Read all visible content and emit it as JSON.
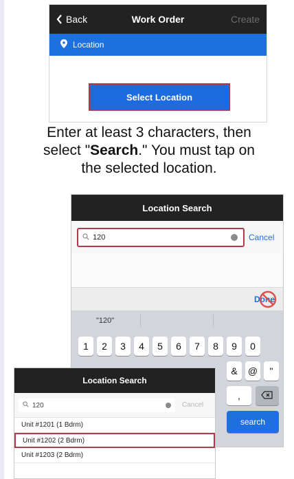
{
  "work_order": {
    "back": "Back",
    "title": "Work Order",
    "create": "Create",
    "location_label": "Location",
    "select_location": "Select Location"
  },
  "caption": {
    "line1": "Enter at least 3 characters, then",
    "line2_pre": "select \"",
    "line2_bold": "Search",
    "line2_post": ".\" You must tap on",
    "line3": "the selected location."
  },
  "keyboard_screen": {
    "title": "Location Search",
    "search_value": "120",
    "cancel": "Cancel",
    "done": "Done",
    "suggestion": "\"120\"",
    "row1": [
      "1",
      "2",
      "3",
      "4",
      "5",
      "6",
      "7",
      "8",
      "9",
      "0"
    ],
    "row2_visible": [
      "&",
      "@",
      "\""
    ],
    "row3_visible": [
      ","
    ],
    "search_key": "search"
  },
  "results_screen": {
    "title": "Location Search",
    "search_value": "120",
    "cancel": "Cancel",
    "results": [
      "Unit #1201 (1 Bdrm)",
      "Unit #1202 (2 Bdrm)",
      "Unit #1203 (2 Bdrm)"
    ],
    "selected_index": 1
  },
  "colors": {
    "accent_blue": "#1c6be0",
    "highlight_red": "#b0394a",
    "bar_dark": "#222222"
  }
}
